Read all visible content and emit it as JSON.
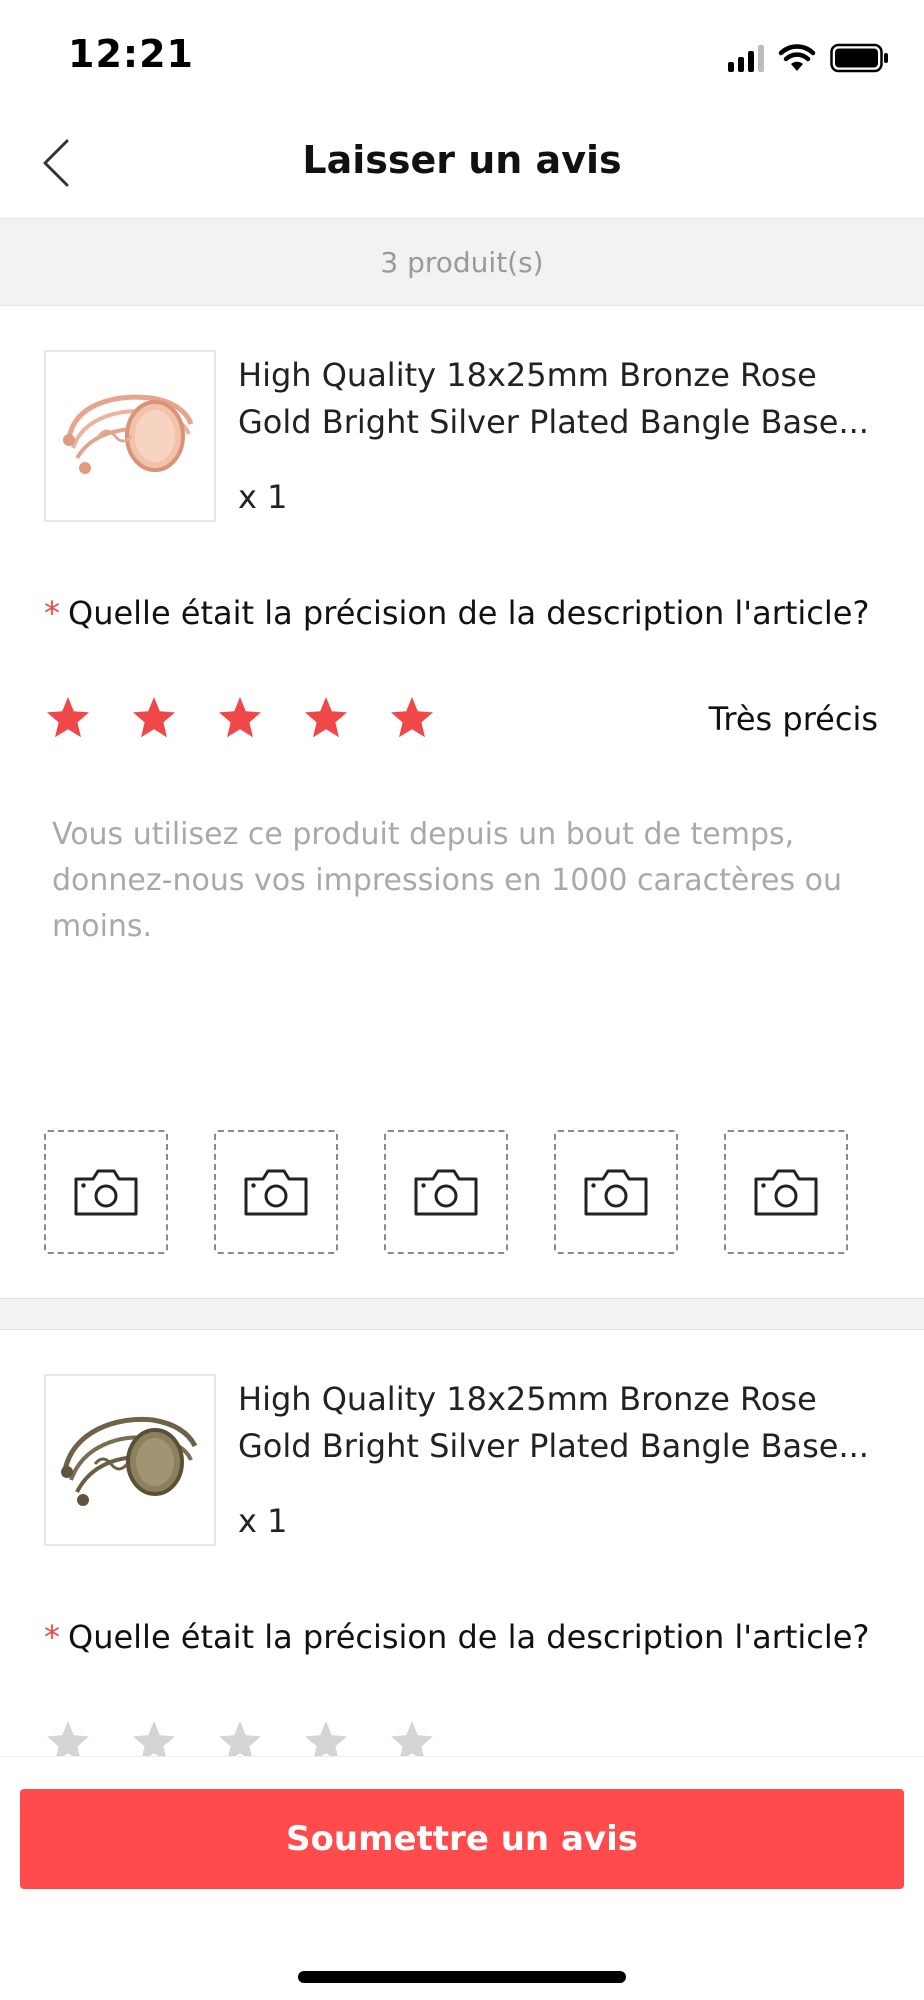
{
  "status_bar": {
    "time": "12:21",
    "icons": [
      "signal-icon",
      "wifi-icon",
      "battery-icon"
    ]
  },
  "header": {
    "title": "Laisser un avis",
    "back_icon": "chevron-left-icon"
  },
  "count_bar": {
    "text": "3 produit(s)"
  },
  "products": [
    {
      "title": "High Quality 18x25mm Bronze Rose Gold Bright Silver Plated Bangle Base...",
      "quantity": "x 1",
      "image": "rose-gold-bangle-image",
      "question_required_mark": "*",
      "question": "Quelle était la précision de la description l'article?",
      "rating": 5,
      "max_rating": 5,
      "rating_label": "Très précis",
      "review_placeholder": "Vous utilisez ce produit depuis un bout de temps, donnez-nous vos impressions en 1000 caractères ou moins.",
      "review_value": "",
      "photo_slots": 5
    },
    {
      "title": "High Quality 18x25mm Bronze Rose Gold Bright Silver Plated Bangle Base...",
      "quantity": "x 1",
      "image": "bronze-bangle-image",
      "question_required_mark": "*",
      "question": "Quelle était la précision de la description l'article?",
      "rating": 0,
      "max_rating": 5
    }
  ],
  "submit_button": {
    "label": "Soumettre un avis"
  },
  "colors": {
    "accent": "#ff4b4b",
    "star_active": "#f04848",
    "star_inactive": "#d4d4d4",
    "placeholder": "#a9a9a9",
    "section_bg": "#f2f2f2"
  }
}
